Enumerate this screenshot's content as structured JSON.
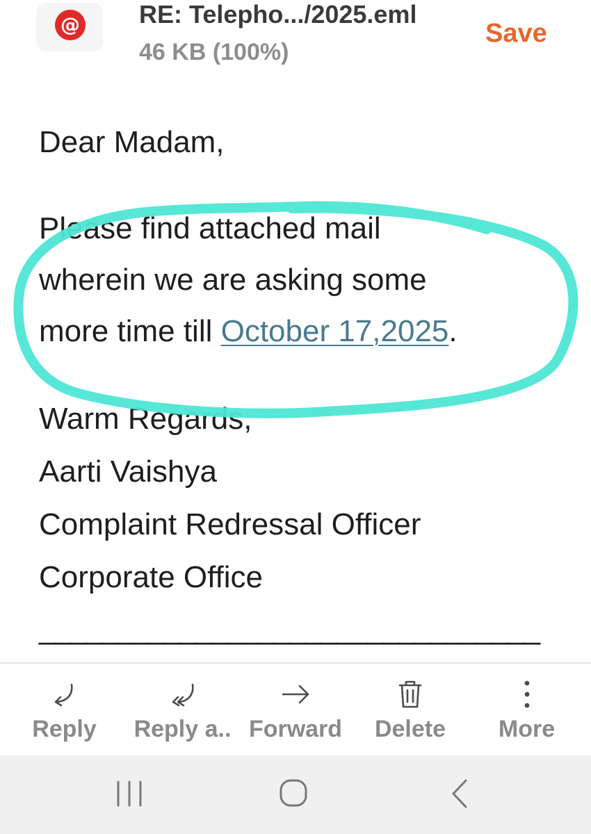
{
  "header": {
    "app_icon_glyph": "@",
    "file_name": "RE: Telepho.../2025.eml",
    "file_size": "46 KB (100%)",
    "save_label": "Save",
    "accent_color": "#e8662b",
    "app_icon_color": "#e02a2a"
  },
  "email": {
    "greeting": "Dear Madam,",
    "paragraph_line1": "Please find attached mail",
    "paragraph_line2": "wherein we are asking some",
    "paragraph_line3_prefix": "more time till ",
    "date_link": "October 17,2025",
    "paragraph_line3_suffix": ".",
    "signature": {
      "closing": "Warm Regards,",
      "name": "Aarti Vaishya",
      "title": "Complaint Redressal Officer",
      "office": "Corporate Office"
    },
    "separator": "________________________________",
    "link_color": "#4a7a8c",
    "highlight_color": "#4ee6d4"
  },
  "actions": [
    {
      "label": "Reply",
      "icon": "reply-icon"
    },
    {
      "label": "Reply a..",
      "icon": "reply-all-icon"
    },
    {
      "label": "Forward",
      "icon": "forward-icon"
    },
    {
      "label": "Delete",
      "icon": "trash-icon"
    },
    {
      "label": "More",
      "icon": "more-vertical-icon"
    }
  ],
  "nav": {
    "recents_icon": "recents-icon",
    "home_icon": "home-icon",
    "back_icon": "back-icon"
  }
}
